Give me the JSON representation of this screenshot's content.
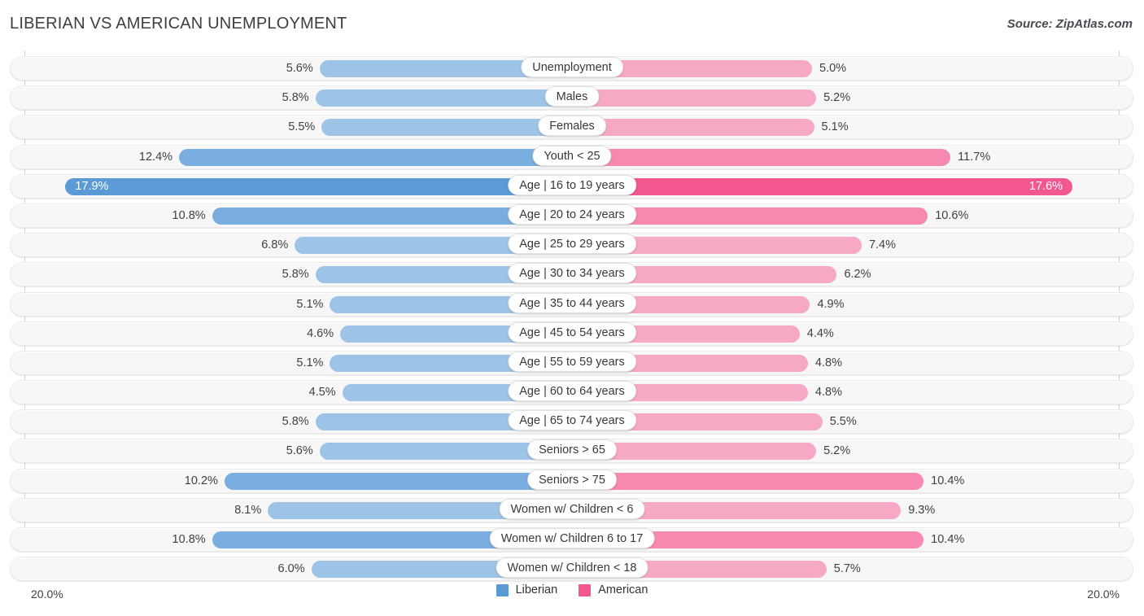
{
  "header": {
    "title": "LIBERIAN VS AMERICAN UNEMPLOYMENT",
    "source": "Source: ZipAtlas.com"
  },
  "axis": {
    "left_label": "20.0%",
    "right_label": "20.0%",
    "max": 20.0
  },
  "legend": {
    "items": [
      {
        "label": "Liberian",
        "color": "#5b9bd5"
      },
      {
        "label": "American",
        "color": "#f2578f"
      }
    ]
  },
  "colors": {
    "liberian_light": "#9dc3e6",
    "liberian_mid": "#7aaee0",
    "liberian_dark": "#5b9bd5",
    "american_light": "#f7a8c4",
    "american_mid": "#f789b0",
    "american_dark": "#f2578f",
    "track": "#f7f7f7",
    "text": "#3f3f46"
  },
  "chart_data": {
    "type": "bar",
    "title": "LIBERIAN VS AMERICAN UNEMPLOYMENT",
    "subtitle": "",
    "xlabel": "",
    "ylabel": "",
    "orientation": "horizontal-diverging",
    "xlim": [
      20.0,
      20.0
    ],
    "grid": false,
    "legend_position": "bottom-center",
    "categories": [
      "Unemployment",
      "Males",
      "Females",
      "Youth < 25",
      "Age | 16 to 19 years",
      "Age | 20 to 24 years",
      "Age | 25 to 29 years",
      "Age | 30 to 34 years",
      "Age | 35 to 44 years",
      "Age | 45 to 54 years",
      "Age | 55 to 59 years",
      "Age | 60 to 64 years",
      "Age | 65 to 74 years",
      "Seniors > 65",
      "Seniors > 75",
      "Women w/ Children < 6",
      "Women w/ Children 6 to 17",
      "Women w/ Children < 18"
    ],
    "series": [
      {
        "name": "Liberian",
        "color": "#5b9bd5",
        "values": [
          5.6,
          5.8,
          5.5,
          12.4,
          17.9,
          10.8,
          6.8,
          5.8,
          5.1,
          4.6,
          5.1,
          4.5,
          5.8,
          5.6,
          10.2,
          8.1,
          10.8,
          6.0
        ],
        "labels": [
          "5.6%",
          "5.8%",
          "5.5%",
          "12.4%",
          "17.9%",
          "10.8%",
          "6.8%",
          "5.8%",
          "5.1%",
          "4.6%",
          "5.1%",
          "4.5%",
          "5.8%",
          "5.6%",
          "10.2%",
          "8.1%",
          "10.8%",
          "6.0%"
        ]
      },
      {
        "name": "American",
        "color": "#f2578f",
        "values": [
          5.0,
          5.2,
          5.1,
          11.7,
          17.6,
          10.6,
          7.4,
          6.2,
          4.9,
          4.4,
          4.8,
          4.8,
          5.5,
          5.2,
          10.4,
          9.3,
          10.4,
          5.7
        ],
        "labels": [
          "5.0%",
          "5.2%",
          "5.1%",
          "11.7%",
          "17.6%",
          "10.6%",
          "7.4%",
          "6.2%",
          "4.9%",
          "4.4%",
          "4.8%",
          "4.8%",
          "5.5%",
          "5.2%",
          "10.4%",
          "9.3%",
          "10.4%",
          "5.7%"
        ]
      }
    ],
    "rows": [
      {
        "category": "Unemployment",
        "left_value": 5.6,
        "left_label": "5.6%",
        "right_value": 5.0,
        "right_label": "5.0%"
      },
      {
        "category": "Males",
        "left_value": 5.8,
        "left_label": "5.8%",
        "right_value": 5.2,
        "right_label": "5.2%"
      },
      {
        "category": "Females",
        "left_value": 5.5,
        "left_label": "5.5%",
        "right_value": 5.1,
        "right_label": "5.1%"
      },
      {
        "category": "Youth < 25",
        "left_value": 12.4,
        "left_label": "12.4%",
        "right_value": 11.7,
        "right_label": "11.7%"
      },
      {
        "category": "Age | 16 to 19 years",
        "left_value": 17.9,
        "left_label": "17.9%",
        "right_value": 17.6,
        "right_label": "17.6%"
      },
      {
        "category": "Age | 20 to 24 years",
        "left_value": 10.8,
        "left_label": "10.8%",
        "right_value": 10.6,
        "right_label": "10.6%"
      },
      {
        "category": "Age | 25 to 29 years",
        "left_value": 6.8,
        "left_label": "6.8%",
        "right_value": 7.4,
        "right_label": "7.4%"
      },
      {
        "category": "Age | 30 to 34 years",
        "left_value": 5.8,
        "left_label": "5.8%",
        "right_value": 6.2,
        "right_label": "6.2%"
      },
      {
        "category": "Age | 35 to 44 years",
        "left_value": 5.1,
        "left_label": "5.1%",
        "right_value": 4.9,
        "right_label": "4.9%"
      },
      {
        "category": "Age | 45 to 54 years",
        "left_value": 4.6,
        "left_label": "4.6%",
        "right_value": 4.4,
        "right_label": "4.4%"
      },
      {
        "category": "Age | 55 to 59 years",
        "left_value": 5.1,
        "left_label": "5.1%",
        "right_value": 4.8,
        "right_label": "4.8%"
      },
      {
        "category": "Age | 60 to 64 years",
        "left_value": 4.5,
        "left_label": "4.5%",
        "right_value": 4.8,
        "right_label": "4.8%"
      },
      {
        "category": "Age | 65 to 74 years",
        "left_value": 5.8,
        "left_label": "5.8%",
        "right_value": 5.5,
        "right_label": "5.5%"
      },
      {
        "category": "Seniors > 65",
        "left_value": 5.6,
        "left_label": "5.6%",
        "right_value": 5.2,
        "right_label": "5.2%"
      },
      {
        "category": "Seniors > 75",
        "left_value": 10.2,
        "left_label": "10.2%",
        "right_value": 10.4,
        "right_label": "10.4%"
      },
      {
        "category": "Women w/ Children < 6",
        "left_value": 8.1,
        "left_label": "8.1%",
        "right_value": 9.3,
        "right_label": "9.3%"
      },
      {
        "category": "Women w/ Children 6 to 17",
        "left_value": 10.8,
        "left_label": "10.8%",
        "right_value": 10.4,
        "right_label": "10.4%"
      },
      {
        "category": "Women w/ Children < 18",
        "left_value": 6.0,
        "left_label": "6.0%",
        "right_value": 5.7,
        "right_label": "5.7%"
      }
    ]
  }
}
